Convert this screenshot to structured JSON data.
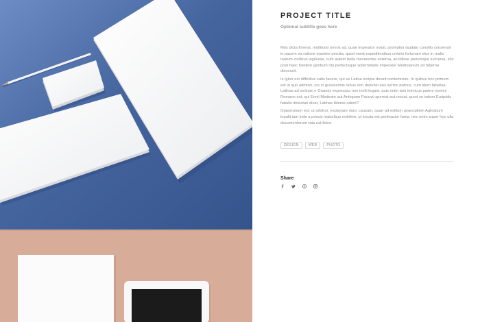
{
  "project": {
    "title": "PROJECT TITLE",
    "subtitle": "Optional subtitle goes here",
    "paragraphs": [
      "Mox dicta finierat, multitudo omnis ad, quae imperator voluit, promptior laudato consilio consensit in pacem ea ratione maxime percita, quod norat expeditionibus crebris fortunam eius in malis tantum civilibus vigilasse, cum autem bella moverentur externa, accidisse plerumque luctuosa, icto post haec foedere gentium ritu perfectaque sollemnitate imperator Mediolanum ad hiberna discessit.",
      "Is igitur est difficilius satis facere, qui se Latina scripta dicunt contemnere. In quibus hoc primum est in quo admirer, cur in gravissimis rebus non delectet eos sermo patrius, cum idem fabellas Latinas ad verbum e Graecis expressas non inviti legant. quis enim tam inimicus paene nomini Romano est, qui Ennii Medeam aut Antiopam Pacuvii spernat aut reiciat, quod se isdem Euripidis fabulis delectari dicat, Latinas litteras oderit?",
      "Opportunum est, ut arbitror, explanare nunc causam, quae ad exitium praecipitem Aginatium inpulit iam inde a priscis maioribus nobilem, ut locuta est pertinacior fama. nec enim super hoc ulla documentorum rata est fides."
    ],
    "tags": [
      "DESIGN",
      "WEB",
      "PHOTO"
    ]
  },
  "share": {
    "heading": "Share",
    "links": [
      {
        "name": "facebook-icon"
      },
      {
        "name": "twitter-icon"
      },
      {
        "name": "pinterest-icon"
      },
      {
        "name": "instagram-icon"
      }
    ]
  },
  "colors": {
    "blue_background": "#3e5f9c",
    "kraft_background": "#d7ac98",
    "paper": "#f6f6f6",
    "title_text": "#2c2c2c",
    "body_text": "#8c8c8c"
  }
}
